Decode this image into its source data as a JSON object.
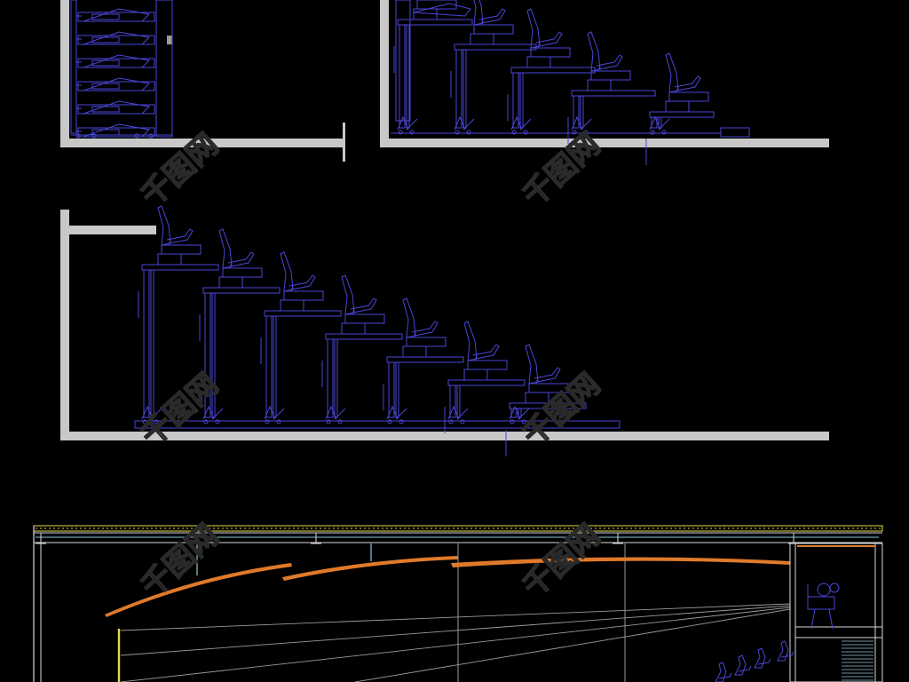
{
  "drawing": {
    "background": "#000000",
    "colors": {
      "wall": "#c8c8c8",
      "seat": "#4a46d8",
      "ceiling_panel": "#e07a2a",
      "roof_band": "#e8d84a",
      "frame": "#d8d8d8",
      "sight_line": "#9a9a9a",
      "screen": "#e8d84a",
      "beam": "#8fc6d6",
      "watermark": "#2a2a2a"
    },
    "views": [
      {
        "kind": "retracted-bleacher-section",
        "tier_count": 6
      },
      {
        "kind": "partially-extended-bleacher-section",
        "tier_count": 5
      },
      {
        "kind": "fully-extended-bleacher-section",
        "tier_count": 7
      },
      {
        "kind": "auditorium-longitudinal-section",
        "panel_count": 3
      }
    ]
  },
  "watermark": {
    "text": "千图网"
  }
}
